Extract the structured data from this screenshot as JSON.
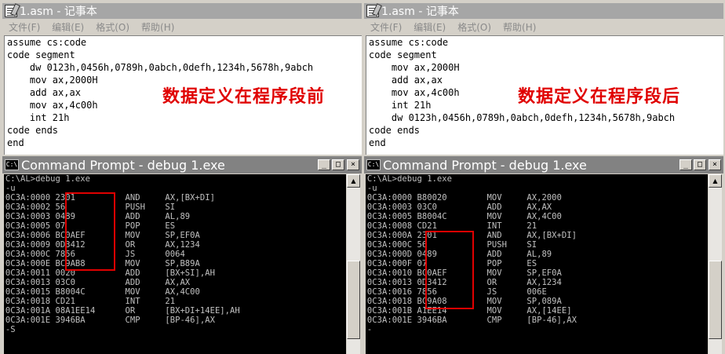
{
  "windows": [
    {
      "id": "left",
      "notepad": {
        "title": "1.asm - 记事本",
        "menu": [
          "文件(F)",
          "编辑(E)",
          "格式(O)",
          "帮助(H)"
        ],
        "lines": [
          "assume cs:code",
          "code segment",
          "    dw 0123h,0456h,0789h,0abch,0defh,1234h,5678h,9abch",
          "    mov ax,2000H",
          "    add ax,ax",
          "    mov ax,4c00h",
          "    int 21h",
          "code ends",
          "end"
        ],
        "caption": "数据定义在程序段前"
      },
      "cmd": {
        "title": "Command Prompt - debug 1.exe",
        "lines": [
          "C:\\AL>debug 1.exe",
          "-u",
          "0C3A:0000 2301          AND     AX,[BX+DI]",
          "0C3A:0002 56            PUSH    SI",
          "0C3A:0003 0489          ADD     AL,89",
          "0C3A:0005 07            POP     ES",
          "0C3A:0006 BC0AEF        MOV     SP,EF0A",
          "0C3A:0009 0D3412        OR      AX,1234",
          "0C3A:000C 7856          JS      0064",
          "0C3A:000E BC9AB8        MOV     SP,B89A",
          "0C3A:0011 0020          ADD     [BX+SI],AH",
          "0C3A:0013 03C0          ADD     AX,AX",
          "0C3A:0015 B8004C        MOV     AX,4C00",
          "0C3A:0018 CD21          INT     21",
          "0C3A:001A 08A1EE14      OR      [BX+DI+14EE],AH",
          "0C3A:001E 3946BA        CMP     [BP-46],AX",
          "-S"
        ]
      }
    },
    {
      "id": "right",
      "notepad": {
        "title": "1.asm - 记事本",
        "menu": [
          "文件(F)",
          "编辑(E)",
          "格式(O)",
          "帮助(H)"
        ],
        "lines": [
          "assume cs:code",
          "code segment",
          "    mov ax,2000H",
          "    add ax,ax",
          "    mov ax,4c00h",
          "    int 21h",
          "    dw 0123h,0456h,0789h,0abch,0defh,1234h,5678h,9abch",
          "code ends",
          "end"
        ],
        "caption": "数据定义在程序段后"
      },
      "cmd": {
        "title": "Command Prompt - debug 1.exe",
        "lines": [
          "C:\\AL>debug 1.exe",
          "-u",
          "0C3A:0000 B80020        MOV     AX,2000",
          "0C3A:0003 03C0          ADD     AX,AX",
          "0C3A:0005 B8004C        MOV     AX,4C00",
          "0C3A:0008 CD21          INT     21",
          "0C3A:000A 2301          AND     AX,[BX+DI]",
          "0C3A:000C 56            PUSH    SI",
          "0C3A:000D 0489          ADD     AL,89",
          "0C3A:000F 07            POP     ES",
          "0C3A:0010 BC0AEF        MOV     SP,EF0A",
          "0C3A:0013 0D3412        OR      AX,1234",
          "0C3A:0016 7856          JS      006E",
          "0C3A:0018 BC9A08        MOV     SP,089A",
          "0C3A:001B A1EE14        MOV     AX,[14EE]",
          "0C3A:001E 3946BA        CMP     [BP-46],AX",
          "-"
        ]
      }
    }
  ],
  "window_buttons": {
    "minimize": "_",
    "maximize": "□",
    "close": "×"
  },
  "icons": {
    "notepad": "notepad-icon",
    "cmd": "command-prompt-icon",
    "cmd_glyph": "C:\\"
  },
  "colors": {
    "caption": "#e00000",
    "highlight_box": "#e00000",
    "console_text": "#c0c0c0",
    "console_bg": "#000000"
  }
}
